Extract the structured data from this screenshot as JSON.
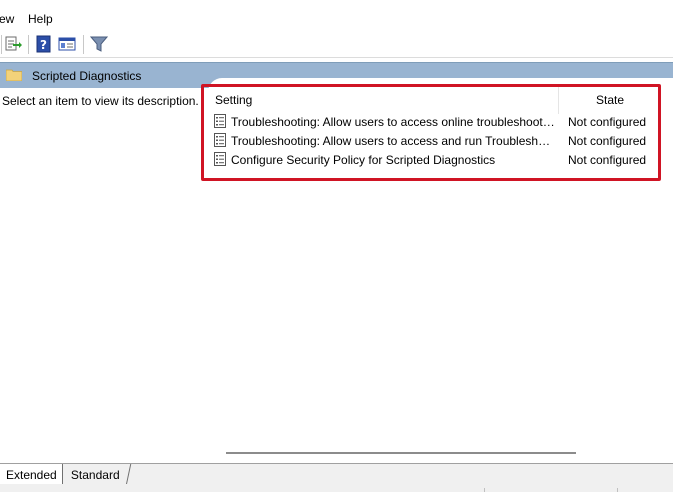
{
  "menubar": {
    "items": [
      "ew",
      "Help"
    ]
  },
  "toolbar": {
    "icons": [
      "export-list-icon",
      "help-icon",
      "show-hide-console-tree-icon",
      "filter-icon"
    ]
  },
  "header": {
    "title": "Scripted Diagnostics",
    "icon": "folder-icon"
  },
  "description": {
    "text": "Select an item to view its description."
  },
  "list": {
    "columns": {
      "setting": "Setting",
      "state": "State"
    },
    "rows": [
      {
        "name": "Troubleshooting: Allow users to access online troubleshooting content on Microsoft servers from the Troubleshooting Control Panel (via the Windows Online Troubleshooting Service - WOTS)",
        "state": "Not configured"
      },
      {
        "name": "Troubleshooting: Allow users to access and run Troubleshooting Wizards",
        "state": "Not configured"
      },
      {
        "name": "Configure Security Policy for Scripted Diagnostics",
        "state": "Not configured"
      }
    ]
  },
  "tabs": [
    "Extended",
    "Standard"
  ],
  "colors": {
    "header_band": "#99b4d1",
    "highlight_border": "#d01424"
  }
}
